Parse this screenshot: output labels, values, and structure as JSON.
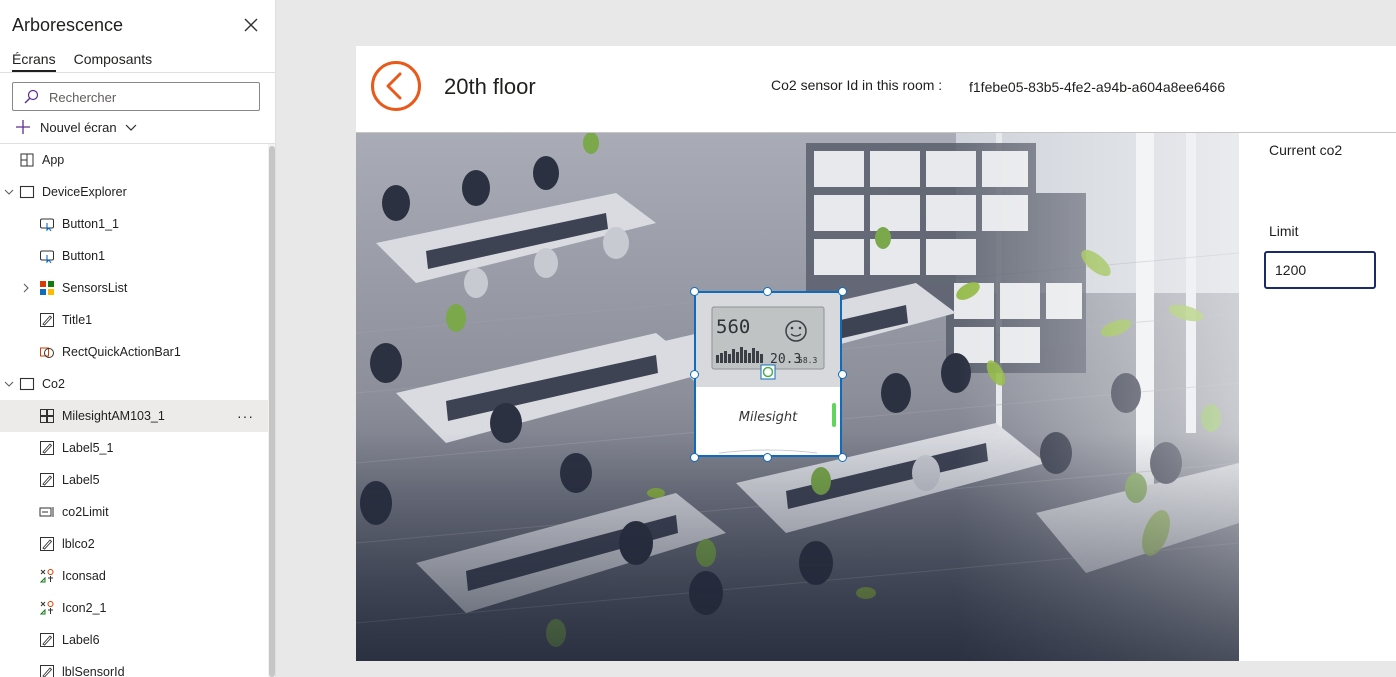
{
  "tree_panel": {
    "title": "Arborescence",
    "tabs": [
      {
        "label": "Écrans",
        "active": true
      },
      {
        "label": "Composants",
        "active": false
      }
    ],
    "search": {
      "placeholder": "Rechercher",
      "value": ""
    },
    "new_screen_label": "Nouvel écran",
    "nodes": [
      {
        "label": "App",
        "icon": "app-icon",
        "level": 0
      },
      {
        "label": "DeviceExplorer",
        "icon": "screen-icon",
        "level": 0,
        "expanded": true
      },
      {
        "label": "Button1_1",
        "icon": "button-icon",
        "level": 1
      },
      {
        "label": "Button1",
        "icon": "button-icon",
        "level": 1
      },
      {
        "label": "SensorsList",
        "icon": "gallery-icon",
        "level": 1,
        "expanded": false
      },
      {
        "label": "Title1",
        "icon": "label-icon",
        "level": 1
      },
      {
        "label": "RectQuickActionBar1",
        "icon": "shape-icon",
        "level": 1
      },
      {
        "label": "Co2",
        "icon": "screen-icon",
        "level": 0,
        "expanded": true
      },
      {
        "label": "MilesightAM103_1",
        "icon": "component-icon",
        "level": 1,
        "selected": true
      },
      {
        "label": "Label5_1",
        "icon": "label-icon",
        "level": 1
      },
      {
        "label": "Label5",
        "icon": "label-icon",
        "level": 1
      },
      {
        "label": "co2Limit",
        "icon": "text-input-icon",
        "level": 1
      },
      {
        "label": "lblco2",
        "icon": "label-icon",
        "level": 1
      },
      {
        "label": "Iconsad",
        "icon": "icons-icon",
        "level": 1
      },
      {
        "label": "Icon2_1",
        "icon": "icons-icon",
        "level": 1
      },
      {
        "label": "Label6",
        "icon": "label-icon",
        "level": 1
      },
      {
        "label": "lblSensorId",
        "icon": "label-icon",
        "level": 1
      }
    ]
  },
  "canvas": {
    "screen_title": "20th floor",
    "sensor_id_label": "Co2 sensor Id in this room :",
    "sensor_id_value": "f1febe05-83b5-4fe2-a94b-a604a8ee6466",
    "current_co2_label": "Current co2",
    "limit_label": "Limit",
    "limit_value": "1200",
    "accent_color": "#e8591a",
    "device": {
      "co2_reading": "560",
      "temperature": "20.3",
      "humidity": "58.3",
      "brand": "Milesight"
    }
  }
}
